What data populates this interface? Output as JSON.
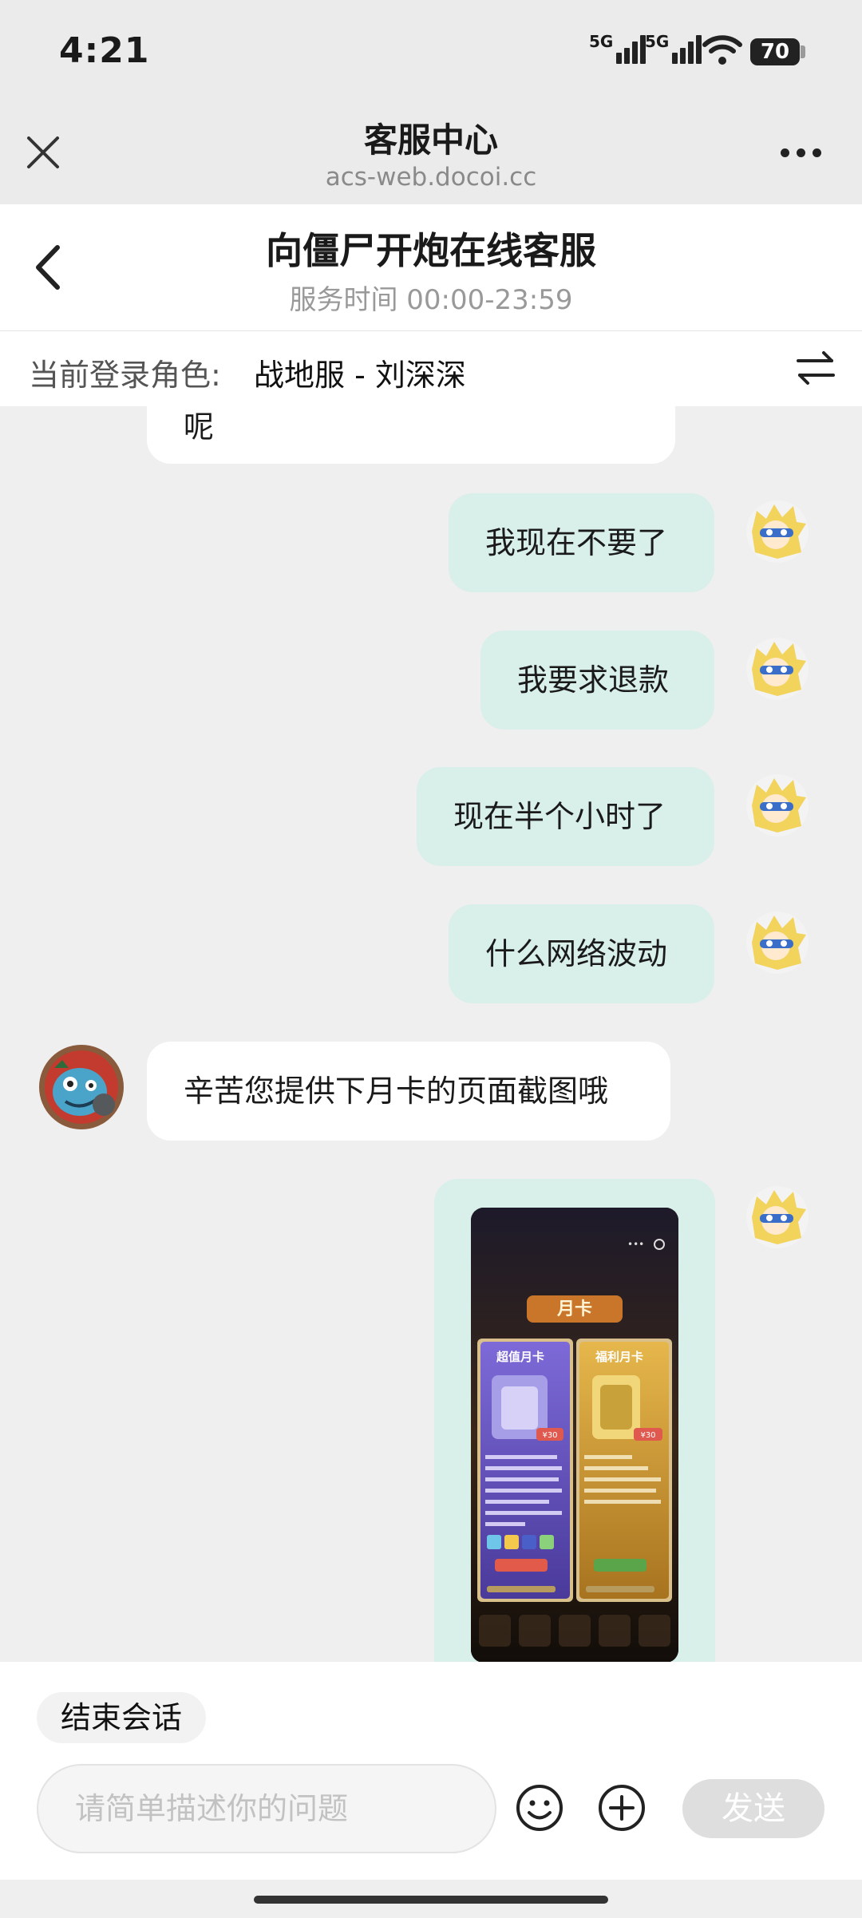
{
  "status_bar": {
    "time": "4:21",
    "signal1_label": "5G",
    "signal2_label": "5G",
    "battery": "70"
  },
  "browser": {
    "title": "客服中心",
    "url": "acs-web.docoi.cc",
    "close_icon": "close-icon",
    "more_icon": "more-icon"
  },
  "cs": {
    "title": "向僵尸开炮在线客服",
    "hours_label": "服务时间",
    "hours_value": "00:00-23:59"
  },
  "role": {
    "label": "当前登录角色:",
    "value": "战地服 - 刘深深",
    "switch_icon": "switch-icon"
  },
  "messages": [
    {
      "from": "agent",
      "text": "呢",
      "partial": true
    },
    {
      "from": "user",
      "text": "我现在不要了"
    },
    {
      "from": "user",
      "text": "我要求退款"
    },
    {
      "from": "user",
      "text": "现在半个小时了"
    },
    {
      "from": "user",
      "text": "什么网络波动"
    },
    {
      "from": "agent",
      "text": "辛苦您提供下月卡的页面截图哦"
    },
    {
      "from": "user",
      "type": "image",
      "content": "月卡页面截图"
    }
  ],
  "screenshot": {
    "heading": "月卡",
    "card_left_title": "超值月卡",
    "card_right_title": "福利月卡",
    "price_left": "¥30",
    "price_right": "¥30"
  },
  "composer": {
    "end_button": "结束会话",
    "placeholder": "请简单描述你的问题",
    "send_button": "发送"
  },
  "colors": {
    "user_bubble": "#d9efea",
    "agent_bubble": "#ffffff",
    "background": "#efefef"
  }
}
